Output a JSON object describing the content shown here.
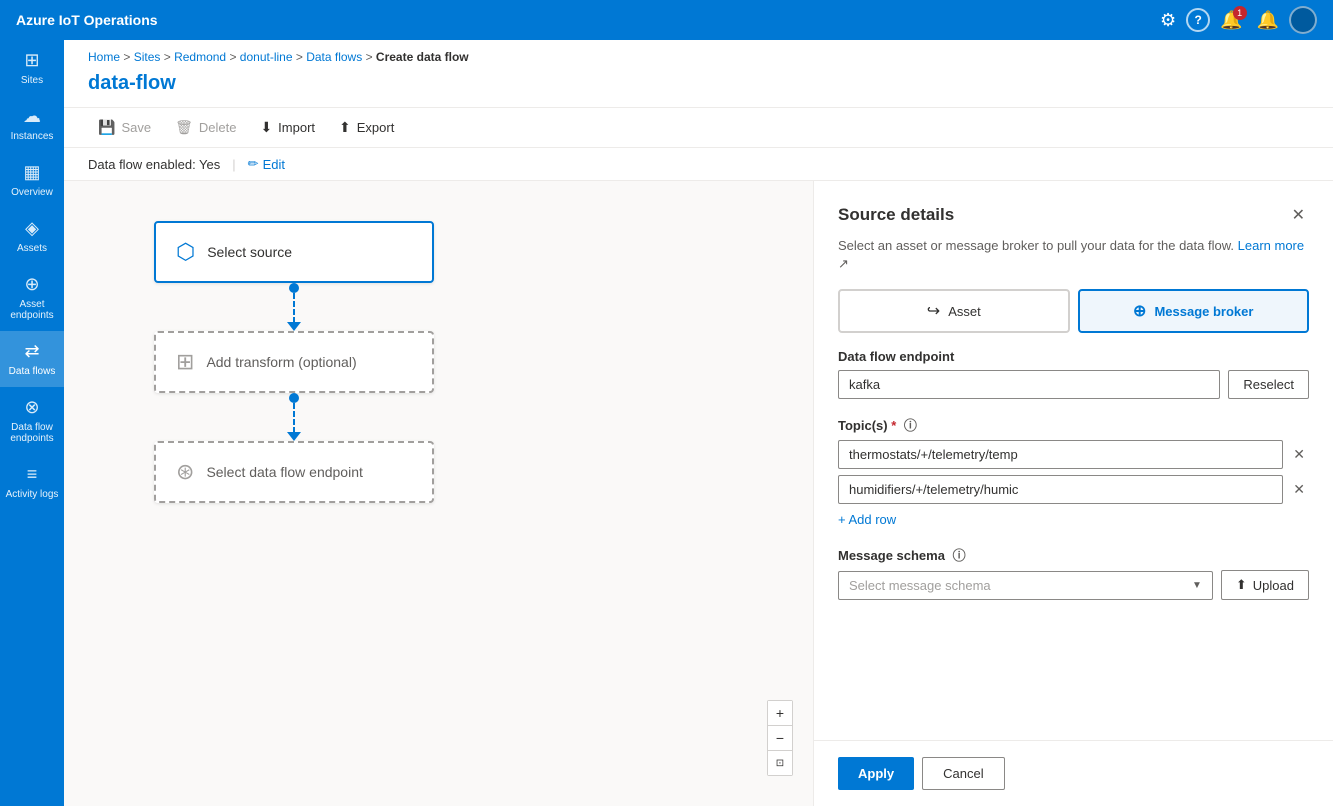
{
  "app": {
    "title": "Azure IoT Operations"
  },
  "topbar": {
    "icons": {
      "settings": "⚙",
      "help": "?",
      "notifications": "🔔",
      "alerts": "🔔",
      "notification_count": "1"
    }
  },
  "sidebar": {
    "items": [
      {
        "id": "sites",
        "label": "Sites",
        "icon": "⊞"
      },
      {
        "id": "instances",
        "label": "Instances",
        "icon": "☁"
      },
      {
        "id": "overview",
        "label": "Overview",
        "icon": "⊟"
      },
      {
        "id": "assets",
        "label": "Assets",
        "icon": "◈"
      },
      {
        "id": "asset-endpoints",
        "label": "Asset endpoints",
        "icon": "⊕"
      },
      {
        "id": "data-flows",
        "label": "Data flows",
        "icon": "⇄",
        "active": true
      },
      {
        "id": "data-flow-endpoints",
        "label": "Data flow endpoints",
        "icon": "⊗"
      },
      {
        "id": "activity-logs",
        "label": "Activity logs",
        "icon": "≡"
      }
    ]
  },
  "breadcrumb": {
    "items": [
      "Home",
      "Sites",
      "Redmond",
      "donut-line",
      "Data flows"
    ],
    "current": "Create data flow"
  },
  "page": {
    "title": "data-flow"
  },
  "toolbar": {
    "save": "Save",
    "delete": "Delete",
    "import": "Import",
    "export": "Export"
  },
  "meta": {
    "status": "Data flow enabled: Yes",
    "edit": "Edit"
  },
  "flow": {
    "source_node_label": "Select source",
    "transform_node_label": "Add transform (optional)",
    "destination_node_label": "Select data flow endpoint"
  },
  "panel": {
    "title": "Source details",
    "description": "Select an asset or message broker to pull your data for the data flow.",
    "learn_more": "Learn more",
    "source_types": [
      {
        "id": "asset",
        "label": "Asset",
        "selected": false
      },
      {
        "id": "message-broker",
        "label": "Message broker",
        "selected": true
      }
    ],
    "endpoint_label": "Data flow endpoint",
    "endpoint_placeholder": "kafka",
    "reselect_label": "Reselect",
    "topics_label": "Topic(s)",
    "topics": [
      {
        "value": "thermostats/+/telemetry/temp"
      },
      {
        "value": "humidifiers/+/telemetry/humic"
      }
    ],
    "add_row_label": "+ Add row",
    "schema_label": "Message schema",
    "schema_placeholder": "Select message schema",
    "upload_label": "Upload",
    "apply_label": "Apply",
    "cancel_label": "Cancel"
  }
}
